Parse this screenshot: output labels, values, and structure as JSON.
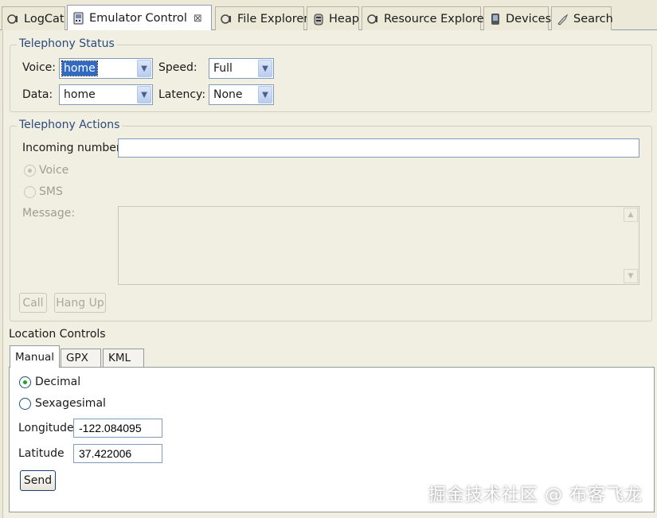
{
  "tabs": [
    {
      "label": "LogCat",
      "icon": "logcat-icon"
    },
    {
      "label": "Emulator Control",
      "icon": "emulator-control-icon",
      "active": true
    },
    {
      "label": "File Explorer",
      "icon": "file-explorer-icon"
    },
    {
      "label": "Heap",
      "icon": "heap-icon"
    },
    {
      "label": "Resource Explorer",
      "icon": "resource-explorer-icon"
    },
    {
      "label": "Devices",
      "icon": "devices-icon"
    },
    {
      "label": "Search",
      "icon": "search-icon"
    }
  ],
  "close_glyph": "⊠",
  "telephony_status": {
    "title": "Telephony Status",
    "voice_label": "Voice:",
    "voice_value": "home",
    "speed_label": "Speed:",
    "speed_value": "Full",
    "data_label": "Data:",
    "data_value": "home",
    "latency_label": "Latency:",
    "latency_value": "None"
  },
  "telephony_actions": {
    "title": "Telephony Actions",
    "incoming_label": "Incoming number:",
    "incoming_value": "",
    "voice_radio": "Voice",
    "sms_radio": "SMS",
    "message_label": "Message:",
    "call_button": "Call",
    "hangup_button": "Hang Up"
  },
  "location": {
    "title": "Location Controls",
    "tabs": [
      "Manual",
      "GPX",
      "KML"
    ],
    "decimal_label": "Decimal",
    "sexagesimal_label": "Sexagesimal",
    "longitude_label": "Longitude",
    "longitude_value": "-122.084095",
    "latitude_label": "Latitude",
    "latitude_value": "37.422006",
    "send_button": "Send"
  },
  "watermark": "掘金技术社区 @ 布客飞龙",
  "colors": {
    "selection": "#316ac5",
    "radio_dot": "#21a121",
    "group_title": "#2c4a7a"
  }
}
